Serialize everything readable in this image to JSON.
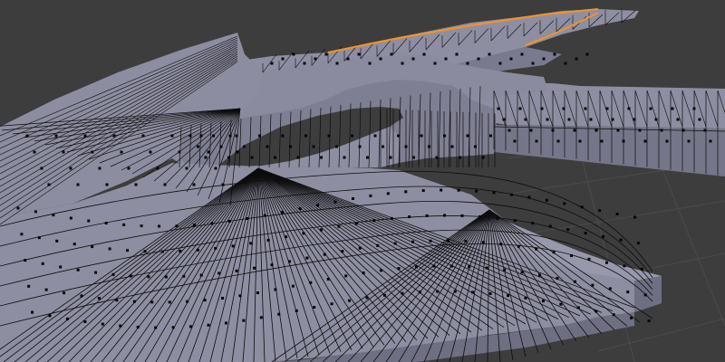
{
  "viewport": {
    "mode": "edit-mode-wireframe-on-shaded",
    "background_color": "#3d3d3d",
    "grid_color": "#4a4a4a",
    "mesh_face_color": "#8d8da1",
    "mesh_side_color": "#7c7c90",
    "mesh_dark_face_color": "#707084",
    "wire_color": "#0d0d0d",
    "vertex_color": "#050505",
    "selected_edge_color": "#f7931e"
  }
}
